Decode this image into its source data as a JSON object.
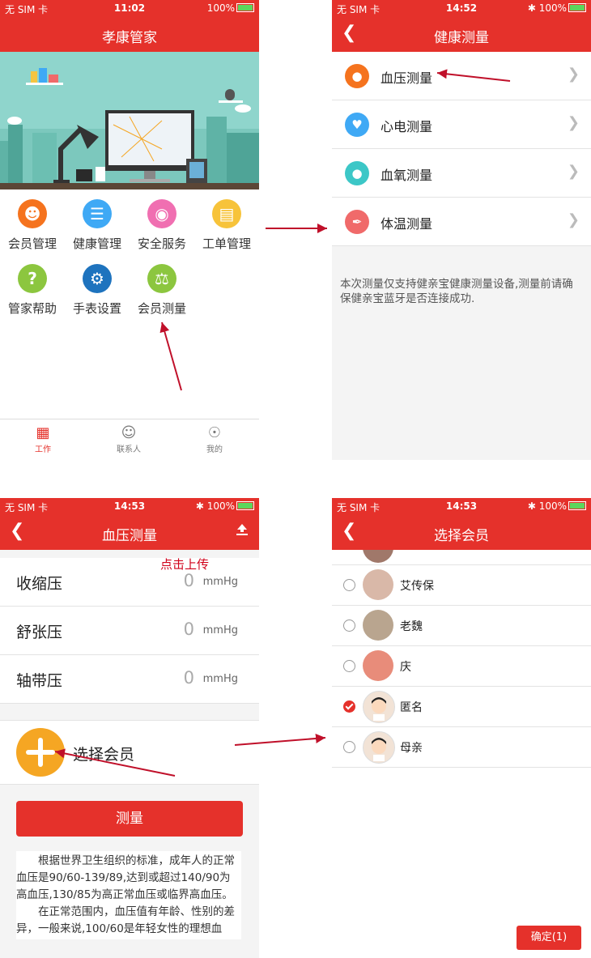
{
  "panel1": {
    "status": {
      "carrier": "无 SIM 卡",
      "time": "11:02",
      "battery": "100%"
    },
    "title": "孝康管家",
    "grid": [
      {
        "label": "会员管理",
        "icon": "members-icon",
        "color": "#f5731e"
      },
      {
        "label": "健康管理",
        "icon": "health-doc-icon",
        "color": "#3fa9f5"
      },
      {
        "label": "安全服务",
        "icon": "location-icon",
        "color": "#f06fb1"
      },
      {
        "label": "工单管理",
        "icon": "folder-icon",
        "color": "#f7c33a"
      },
      {
        "label": "管家帮助",
        "icon": "help-icon",
        "color": "#8cc63f"
      },
      {
        "label": "手表设置",
        "icon": "gear-icon",
        "color": "#1e73be"
      },
      {
        "label": "会员测量",
        "icon": "scale-icon",
        "color": "#8cc63f"
      }
    ],
    "tabs": [
      {
        "label": "工作",
        "icon": "work-icon"
      },
      {
        "label": "联系人",
        "icon": "contacts-icon"
      },
      {
        "label": "我的",
        "icon": "profile-icon"
      }
    ]
  },
  "panel2": {
    "status": {
      "carrier": "无 SIM 卡",
      "time": "14:52",
      "battery": "100%"
    },
    "title": "健康测量",
    "items": [
      {
        "label": "血压测量",
        "color": "#f5731e"
      },
      {
        "label": "心电测量",
        "color": "#3fa9f5"
      },
      {
        "label": "血氧测量",
        "color": "#3cc7c7"
      },
      {
        "label": "体温测量",
        "color": "#f06a6a"
      }
    ],
    "note": "本次测量仅支持健亲宝健康测量设备,测量前请确保健亲宝蓝牙是否连接成功."
  },
  "panel3": {
    "status": {
      "carrier": "无 SIM 卡",
      "time": "14:53",
      "battery": "100%"
    },
    "title": "血压测量",
    "annotation": "点击上传",
    "rows": [
      {
        "label": "收缩压",
        "value": "0",
        "unit": "mmHg"
      },
      {
        "label": "舒张压",
        "value": "0",
        "unit": "mmHg"
      },
      {
        "label": "轴带压",
        "value": "0",
        "unit": "mmHg"
      }
    ],
    "select_member": "选择会员",
    "measure_button": "测量",
    "info_p1": "根据世界卫生组织的标准，成年人的正常血压是90/60-139/89,达到或超过140/90为高血压,130/85为高正常血压或临界高血压。",
    "info_p2": "在正常范围内，血压值有年龄、性别的差异，一般来说,100/60是年轻女性的理想血"
  },
  "panel4": {
    "status": {
      "carrier": "无 SIM 卡",
      "time": "14:53",
      "battery": "100%"
    },
    "title": "选择会员",
    "members": [
      {
        "name": "艾传保",
        "checked": false,
        "color": "#d9b8a8"
      },
      {
        "name": "老魏",
        "checked": false,
        "color": "#b9a58f"
      },
      {
        "name": "庆",
        "checked": false,
        "color": "#e88c7a"
      },
      {
        "name": "匿名",
        "checked": true,
        "color": "#f2e3d6"
      },
      {
        "name": "母亲",
        "checked": false,
        "color": "#f2e3d6"
      }
    ],
    "confirm": "确定(1)"
  }
}
